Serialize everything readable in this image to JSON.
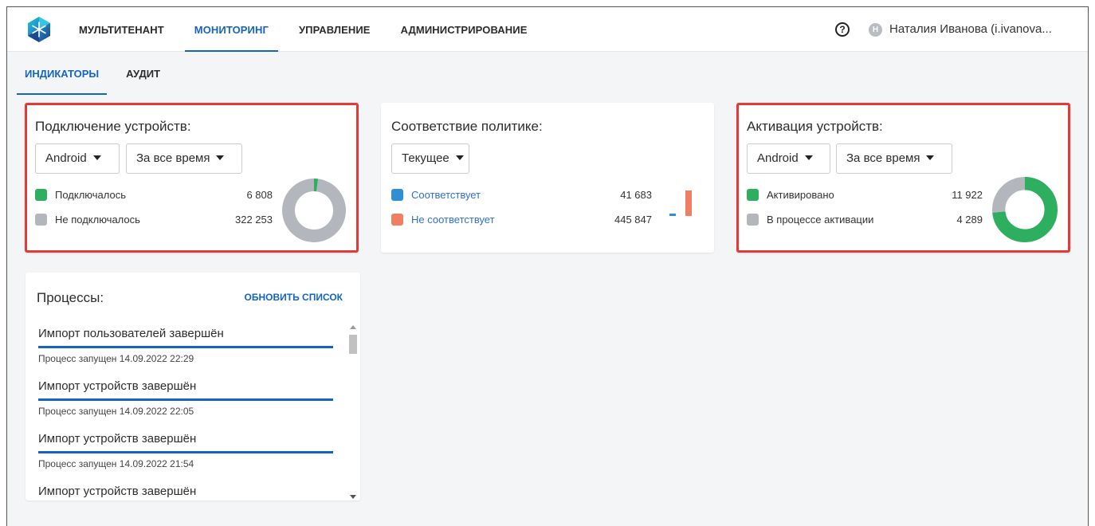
{
  "nav": {
    "items": [
      {
        "label": "МУЛЬТИТЕНАНТ",
        "active": false
      },
      {
        "label": "МОНИТОРИНГ",
        "active": true
      },
      {
        "label": "УПРАВЛЕНИЕ",
        "active": false
      },
      {
        "label": "АДМИНИСТРИРОВАНИЕ",
        "active": false
      }
    ]
  },
  "header": {
    "help_icon": "question-circle-icon",
    "avatar_initial": "Н",
    "user_name": "Наталия Иванова (i.ivanova..."
  },
  "subtabs": [
    {
      "label": "ИНДИКАТОРЫ",
      "active": true
    },
    {
      "label": "АУДИТ",
      "active": false
    }
  ],
  "connection": {
    "title": "Подключение устройств:",
    "platform": "Android",
    "period": "За все время",
    "items": [
      {
        "label": "Подключалось",
        "value": "6 808",
        "color": "#2eaf5f"
      },
      {
        "label": "Не подключалось",
        "value": "322 253",
        "color": "#b3b7bd"
      }
    ]
  },
  "compliance": {
    "title": "Соответствие политике:",
    "period": "Текущее",
    "items": [
      {
        "label": "Соответствует",
        "value": "41 683",
        "color": "#2f8fd6"
      },
      {
        "label": "Не соответствует",
        "value": "445 847",
        "color": "#f07e63"
      }
    ]
  },
  "activation": {
    "title": "Активация устройств:",
    "platform": "Android",
    "period": "За все время",
    "items": [
      {
        "label": "Активировано",
        "value": "11 922",
        "color": "#2eaf5f"
      },
      {
        "label": "В процессе активации",
        "value": "4 289",
        "color": "#b3b7bd"
      }
    ]
  },
  "processes": {
    "title": "Процессы:",
    "refresh_label": "ОБНОВИТЬ СПИСОК",
    "items": [
      {
        "name": "Импорт пользователей завершён",
        "time": "Процесс запущен 14.09.2022 22:29",
        "progress": 1.0
      },
      {
        "name": "Импорт устройств завершён",
        "time": "Процесс запущен 14.09.2022 22:05",
        "progress": 1.0
      },
      {
        "name": "Импорт устройств завершён",
        "time": "Процесс запущен 14.09.2022 21:54",
        "progress": 1.0
      },
      {
        "name": "Импорт устройств завершён",
        "time": "",
        "progress": 1.0
      }
    ]
  },
  "chart_data": [
    {
      "type": "pie",
      "categories": [
        "Подключалось",
        "Не подключалось"
      ],
      "values": [
        6808,
        322253
      ],
      "colors": [
        "#2eaf5f",
        "#b3b7bd"
      ]
    },
    {
      "type": "bar",
      "categories": [
        "Соответствует",
        "Не соответствует"
      ],
      "values": [
        41683,
        445847
      ],
      "colors": [
        "#2f8fd6",
        "#f07e63"
      ]
    },
    {
      "type": "pie",
      "categories": [
        "Активировано",
        "В процессе активации"
      ],
      "values": [
        11922,
        4289
      ],
      "colors": [
        "#2eaf5f",
        "#b3b7bd"
      ]
    }
  ]
}
